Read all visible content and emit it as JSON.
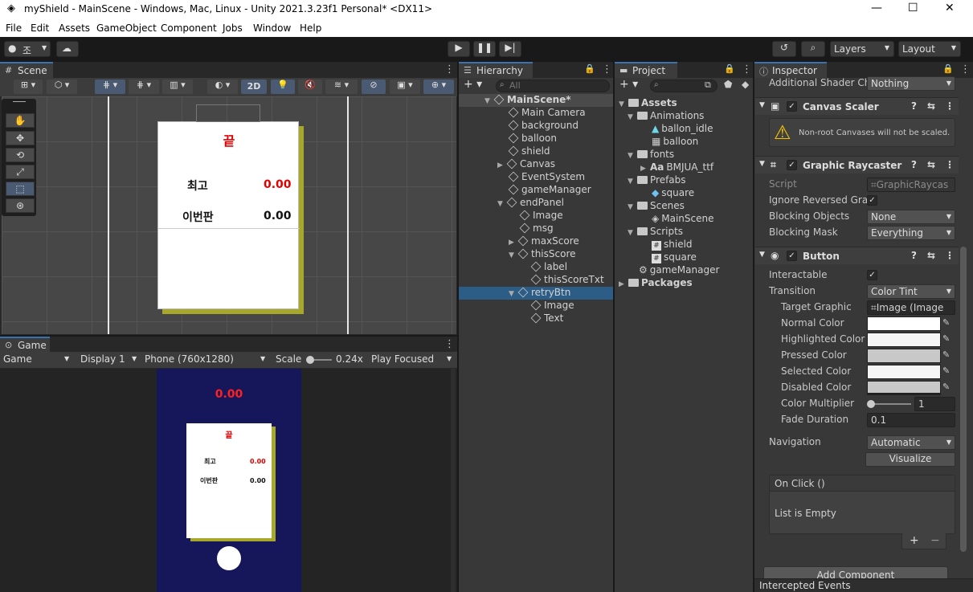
{
  "window": {
    "title": "myShield - MainScene - Windows, Mac, Linux - Unity 2021.3.23f1 Personal* <DX11>",
    "minimize": "—",
    "maximize": "☐",
    "close": "✕"
  },
  "menu": [
    "File",
    "Edit",
    "Assets",
    "GameObject",
    "Component",
    "Jobs",
    "Window",
    "Help"
  ],
  "toolbar": {
    "account_label": "조",
    "layers_label": "Layers",
    "layout_label": "Layout"
  },
  "scene": {
    "tab_label": "Scene",
    "two_d_label": "2D",
    "canvas_title": "끝",
    "best_label": "최고",
    "best_value": "0.00",
    "this_label": "이번판",
    "this_value": "0.00"
  },
  "game": {
    "tab_label": "Game",
    "view_label": "Game",
    "display_label": "Display 1",
    "resolution_label": "Phone (760x1280)",
    "scale_label": "Scale",
    "scale_value": "0.24x",
    "play_mode_label": "Play Focused",
    "score": "0.00",
    "panel_title": "끝",
    "best_label": "최고",
    "best_value": "0.00",
    "this_label": "이번판",
    "this_value": "0.00"
  },
  "hierarchy": {
    "tab_label": "Hierarchy",
    "search_placeholder": "All",
    "items": [
      {
        "label": "MainScene*",
        "depth": 0,
        "expanded": true
      },
      {
        "label": "Main Camera",
        "depth": 1
      },
      {
        "label": "background",
        "depth": 1
      },
      {
        "label": "balloon",
        "depth": 1
      },
      {
        "label": "shield",
        "depth": 1
      },
      {
        "label": "Canvas",
        "depth": 1,
        "collapsed": true
      },
      {
        "label": "EventSystem",
        "depth": 1
      },
      {
        "label": "gameManager",
        "depth": 1
      },
      {
        "label": "endPanel",
        "depth": 1,
        "expanded": true
      },
      {
        "label": "Image",
        "depth": 2
      },
      {
        "label": "msg",
        "depth": 2
      },
      {
        "label": "maxScore",
        "depth": 2,
        "collapsed": true
      },
      {
        "label": "thisScore",
        "depth": 2,
        "expanded": true
      },
      {
        "label": "label",
        "depth": 3
      },
      {
        "label": "thisScoreTxt",
        "depth": 3
      },
      {
        "label": "retryBtn",
        "depth": 2,
        "expanded": true,
        "selected": true
      },
      {
        "label": "Image",
        "depth": 3
      },
      {
        "label": "Text",
        "depth": 3
      }
    ]
  },
  "project": {
    "tab_label": "Project",
    "items": [
      {
        "label": "Assets",
        "depth": 0,
        "type": "folder",
        "bold": true
      },
      {
        "label": "Animations",
        "depth": 1,
        "type": "folder"
      },
      {
        "label": "ballon_idle",
        "depth": 2,
        "type": "anim"
      },
      {
        "label": "balloon",
        "depth": 2,
        "type": "anim"
      },
      {
        "label": "fonts",
        "depth": 1,
        "type": "folder"
      },
      {
        "label": "BMJUA_ttf",
        "depth": 2,
        "type": "font"
      },
      {
        "label": "Prefabs",
        "depth": 1,
        "type": "folder"
      },
      {
        "label": "square",
        "depth": 2,
        "type": "prefab"
      },
      {
        "label": "Scenes",
        "depth": 1,
        "type": "folder"
      },
      {
        "label": "MainScene",
        "depth": 2,
        "type": "scene"
      },
      {
        "label": "Scripts",
        "depth": 1,
        "type": "folder"
      },
      {
        "label": "shield",
        "depth": 2,
        "type": "script"
      },
      {
        "label": "square",
        "depth": 2,
        "type": "script"
      },
      {
        "label": "gameManager",
        "depth": 1,
        "type": "gear"
      },
      {
        "label": "Packages",
        "depth": 0,
        "type": "folder",
        "bold": true
      }
    ]
  },
  "inspector": {
    "tab_label": "Inspector",
    "additional_shader_label": "Additional Shader Ch",
    "additional_shader_value": "Nothing",
    "canvas_scaler_title": "Canvas Scaler",
    "canvas_scaler_warning": "Non-root Canvases will not be scaled.",
    "raycaster_title": "Graphic Raycaster",
    "script_label": "Script",
    "script_value": "GraphicRaycas",
    "ignore_reversed_label": "Ignore Reversed Grap",
    "blocking_objects_label": "Blocking Objects",
    "blocking_objects_value": "None",
    "blocking_mask_label": "Blocking Mask",
    "blocking_mask_value": "Everything",
    "button_title": "Button",
    "interactable_label": "Interactable",
    "transition_label": "Transition",
    "transition_value": "Color Tint",
    "target_graphic_label": "Target Graphic",
    "target_graphic_value": "Image (Image",
    "normal_color_label": "Normal Color",
    "highlighted_color_label": "Highlighted Color",
    "pressed_color_label": "Pressed Color",
    "selected_color_label": "Selected Color",
    "disabled_color_label": "Disabled Color",
    "color_multiplier_label": "Color Multiplier",
    "color_multiplier_value": "1",
    "fade_duration_label": "Fade Duration",
    "fade_duration_value": "0.1",
    "navigation_label": "Navigation",
    "navigation_value": "Automatic",
    "visualize_label": "Visualize",
    "onclick_label": "On Click ()",
    "list_empty_label": "List is Empty",
    "add_component_label": "Add Component",
    "intercepted_events_label": "Intercepted Events",
    "colors": {
      "normal": "#ffffff",
      "highlighted": "#f5f5f5",
      "pressed": "#c8c8c8",
      "selected": "#f5f5f5",
      "disabled": "#c8c8c8"
    }
  }
}
